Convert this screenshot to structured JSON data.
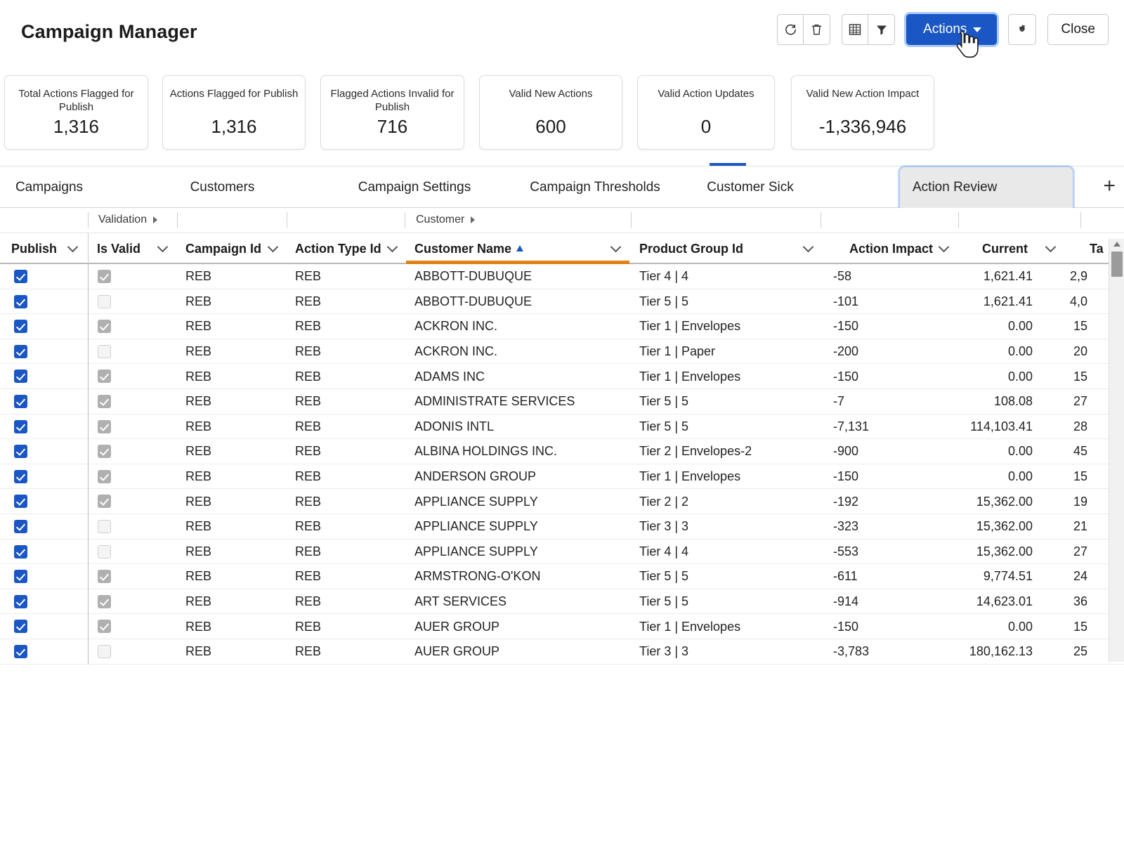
{
  "header": {
    "title": "Campaign Manager",
    "toolbar": {
      "refresh_icon": "refresh-icon",
      "delete_icon": "trash-icon",
      "table_icon": "grid-view-icon",
      "filter_icon": "filter-icon",
      "actions_label": "Actions",
      "settings_icon": "gear-icon",
      "close_label": "Close",
      "accent_color": "#1a56c4"
    }
  },
  "kpis": [
    {
      "label": "Total Actions Flagged for Publish",
      "value": "1,316"
    },
    {
      "label": "Actions Flagged for Publish",
      "value": "1,316"
    },
    {
      "label": "Flagged Actions Invalid for Publish",
      "value": "716"
    },
    {
      "label": "Valid New Actions",
      "value": "600"
    },
    {
      "label": "Valid Action Updates",
      "value": "0"
    },
    {
      "label": "Valid New Action Impact",
      "value": "-1,336,946"
    }
  ],
  "tabs": {
    "items": [
      {
        "label": "Campaigns",
        "active": false
      },
      {
        "label": "Customers",
        "active": false
      },
      {
        "label": "Campaign Settings",
        "active": false
      },
      {
        "label": "Campaign Thresholds",
        "active": false
      },
      {
        "label": "Customer Sick",
        "active": false
      },
      {
        "label": "Action Review",
        "active": true
      }
    ],
    "add_label": "+"
  },
  "grid": {
    "group_headers": [
      {
        "label": "Validation"
      },
      {
        "label": "Customer"
      }
    ],
    "columns": [
      {
        "key": "publish",
        "label": "Publish",
        "type": "checkbox"
      },
      {
        "key": "is_valid",
        "label": "Is Valid",
        "type": "checkbox"
      },
      {
        "key": "campaign",
        "label": "Campaign Id",
        "type": "text"
      },
      {
        "key": "action_type",
        "label": "Action Type Id",
        "type": "text"
      },
      {
        "key": "customer",
        "label": "Customer Name",
        "type": "text",
        "sorted": "asc"
      },
      {
        "key": "product",
        "label": "Product Group Id",
        "type": "text"
      },
      {
        "key": "impact",
        "label": "Action Impact",
        "type": "num"
      },
      {
        "key": "current",
        "label": "Current",
        "type": "num"
      },
      {
        "key": "target",
        "label": "Ta",
        "type": "num"
      }
    ],
    "sort_underline_color": "#e08214",
    "rows": [
      {
        "publish": true,
        "is_valid": true,
        "campaign": "REB",
        "action_type": "REB",
        "customer": "ABBOTT-DUBUQUE",
        "product": "Tier 4 | 4",
        "impact": "-58",
        "current": "1,621.41",
        "target": "2,9"
      },
      {
        "publish": true,
        "is_valid": false,
        "campaign": "REB",
        "action_type": "REB",
        "customer": "ABBOTT-DUBUQUE",
        "product": "Tier 5 | 5",
        "impact": "-101",
        "current": "1,621.41",
        "target": "4,0"
      },
      {
        "publish": true,
        "is_valid": true,
        "campaign": "REB",
        "action_type": "REB",
        "customer": "ACKRON INC.",
        "product": "Tier 1 | Envelopes",
        "impact": "-150",
        "current": "0.00",
        "target": "15"
      },
      {
        "publish": true,
        "is_valid": false,
        "campaign": "REB",
        "action_type": "REB",
        "customer": "ACKRON INC.",
        "product": "Tier 1 | Paper",
        "impact": "-200",
        "current": "0.00",
        "target": "20"
      },
      {
        "publish": true,
        "is_valid": true,
        "campaign": "REB",
        "action_type": "REB",
        "customer": "ADAMS INC",
        "product": "Tier 1 | Envelopes",
        "impact": "-150",
        "current": "0.00",
        "target": "15"
      },
      {
        "publish": true,
        "is_valid": true,
        "campaign": "REB",
        "action_type": "REB",
        "customer": "ADMINISTRATE SERVICES",
        "product": "Tier 5 | 5",
        "impact": "-7",
        "current": "108.08",
        "target": "27"
      },
      {
        "publish": true,
        "is_valid": true,
        "campaign": "REB",
        "action_type": "REB",
        "customer": "ADONIS INTL",
        "product": "Tier 5 | 5",
        "impact": "-7,131",
        "current": "114,103.41",
        "target": "28"
      },
      {
        "publish": true,
        "is_valid": true,
        "campaign": "REB",
        "action_type": "REB",
        "customer": "ALBINA HOLDINGS INC.",
        "product": "Tier 2 | Envelopes-2",
        "impact": "-900",
        "current": "0.00",
        "target": "45"
      },
      {
        "publish": true,
        "is_valid": true,
        "campaign": "REB",
        "action_type": "REB",
        "customer": "ANDERSON GROUP",
        "product": "Tier 1 | Envelopes",
        "impact": "-150",
        "current": "0.00",
        "target": "15"
      },
      {
        "publish": true,
        "is_valid": true,
        "campaign": "REB",
        "action_type": "REB",
        "customer": "APPLIANCE SUPPLY",
        "product": "Tier 2 | 2",
        "impact": "-192",
        "current": "15,362.00",
        "target": "19"
      },
      {
        "publish": true,
        "is_valid": false,
        "campaign": "REB",
        "action_type": "REB",
        "customer": "APPLIANCE SUPPLY",
        "product": "Tier 3 | 3",
        "impact": "-323",
        "current": "15,362.00",
        "target": "21"
      },
      {
        "publish": true,
        "is_valid": false,
        "campaign": "REB",
        "action_type": "REB",
        "customer": "APPLIANCE SUPPLY",
        "product": "Tier 4 | 4",
        "impact": "-553",
        "current": "15,362.00",
        "target": "27"
      },
      {
        "publish": true,
        "is_valid": true,
        "campaign": "REB",
        "action_type": "REB",
        "customer": "ARMSTRONG-O'KON",
        "product": "Tier 5 | 5",
        "impact": "-611",
        "current": "9,774.51",
        "target": "24"
      },
      {
        "publish": true,
        "is_valid": true,
        "campaign": "REB",
        "action_type": "REB",
        "customer": "ART SERVICES",
        "product": "Tier 5 | 5",
        "impact": "-914",
        "current": "14,623.01",
        "target": "36"
      },
      {
        "publish": true,
        "is_valid": true,
        "campaign": "REB",
        "action_type": "REB",
        "customer": "AUER GROUP",
        "product": "Tier 1 | Envelopes",
        "impact": "-150",
        "current": "0.00",
        "target": "15"
      },
      {
        "publish": true,
        "is_valid": false,
        "campaign": "REB",
        "action_type": "REB",
        "customer": "AUER GROUP",
        "product": "Tier 3 | 3",
        "impact": "-3,783",
        "current": "180,162.13",
        "target": "25"
      }
    ]
  }
}
